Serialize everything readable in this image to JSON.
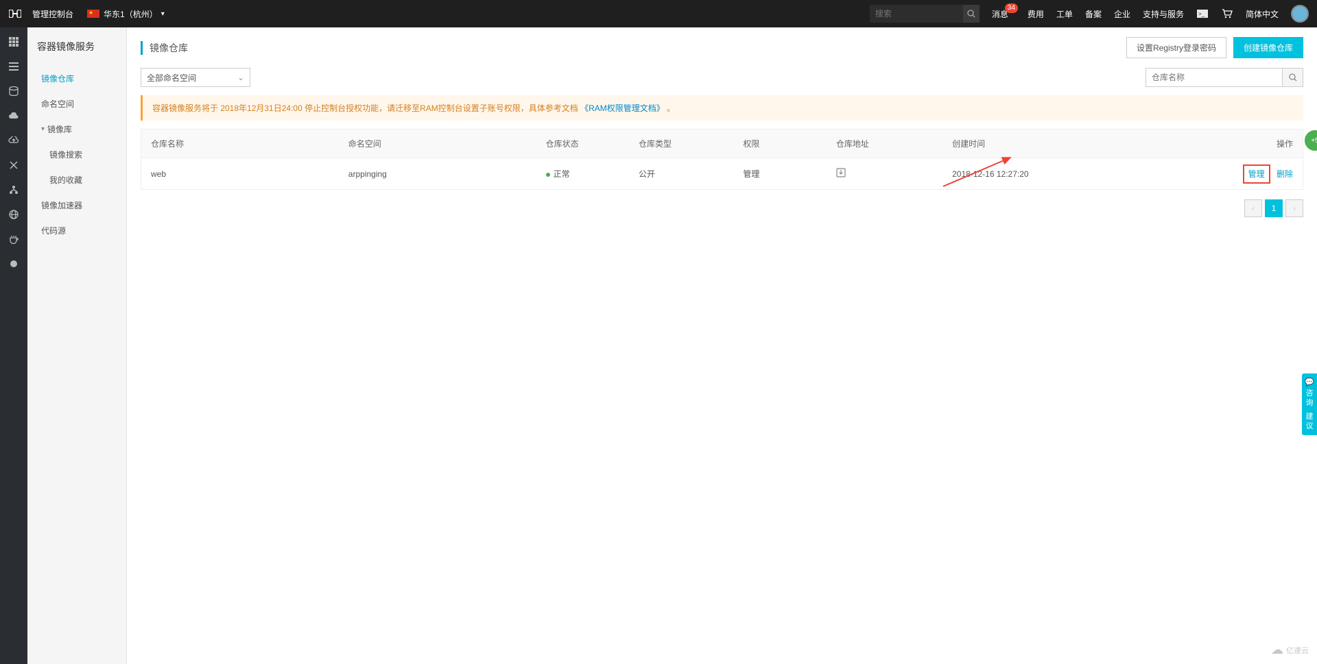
{
  "topbar": {
    "console_label": "管理控制台",
    "region_label": "华东1（杭州）",
    "search_placeholder": "搜索",
    "message_label": "消息",
    "message_badge": "34",
    "nav": {
      "cost": "费用",
      "workorder": "工单",
      "beian": "备案",
      "enterprise": "企业",
      "support": "支持与服务",
      "lang": "简体中文"
    }
  },
  "sidebar": {
    "title": "容器镜像服务",
    "items": {
      "repo": "镜像仓库",
      "namespace": "命名空间",
      "mirror_lib": "镜像库",
      "search": "镜像搜索",
      "fav": "我的收藏",
      "accel": "镜像加速器",
      "source": "代码源"
    }
  },
  "page": {
    "title": "镜像仓库",
    "btn_set_pwd": "设置Registry登录密码",
    "btn_create": "创建镜像仓库"
  },
  "filter": {
    "namespace_select": "全部命名空间",
    "search_placeholder": "仓库名称"
  },
  "banner": {
    "text_before": "容器镜像服务将于 2018年12月31日24:00 停止控制台授权功能，请迁移至RAM控制台设置子账号权限，具体参考文档 ",
    "link_text": "《RAM权限管理文档》",
    "text_after": "。"
  },
  "table": {
    "headers": {
      "name": "仓库名称",
      "namespace": "命名空间",
      "status": "仓库状态",
      "type": "仓库类型",
      "auth": "权限",
      "addr": "仓库地址",
      "created": "创建时间",
      "actions": "操作"
    },
    "row": {
      "name": "web",
      "namespace": "arppinging",
      "status": "正常",
      "type": "公开",
      "auth": "管理",
      "created": "2018-12-16 12:27:20",
      "action_manage": "管理",
      "action_delete": "删除"
    }
  },
  "pagination": {
    "page1": "1"
  },
  "float": {
    "consult": "咨询",
    "suggest": "建议"
  },
  "watermark": {
    "text": "亿速云"
  }
}
